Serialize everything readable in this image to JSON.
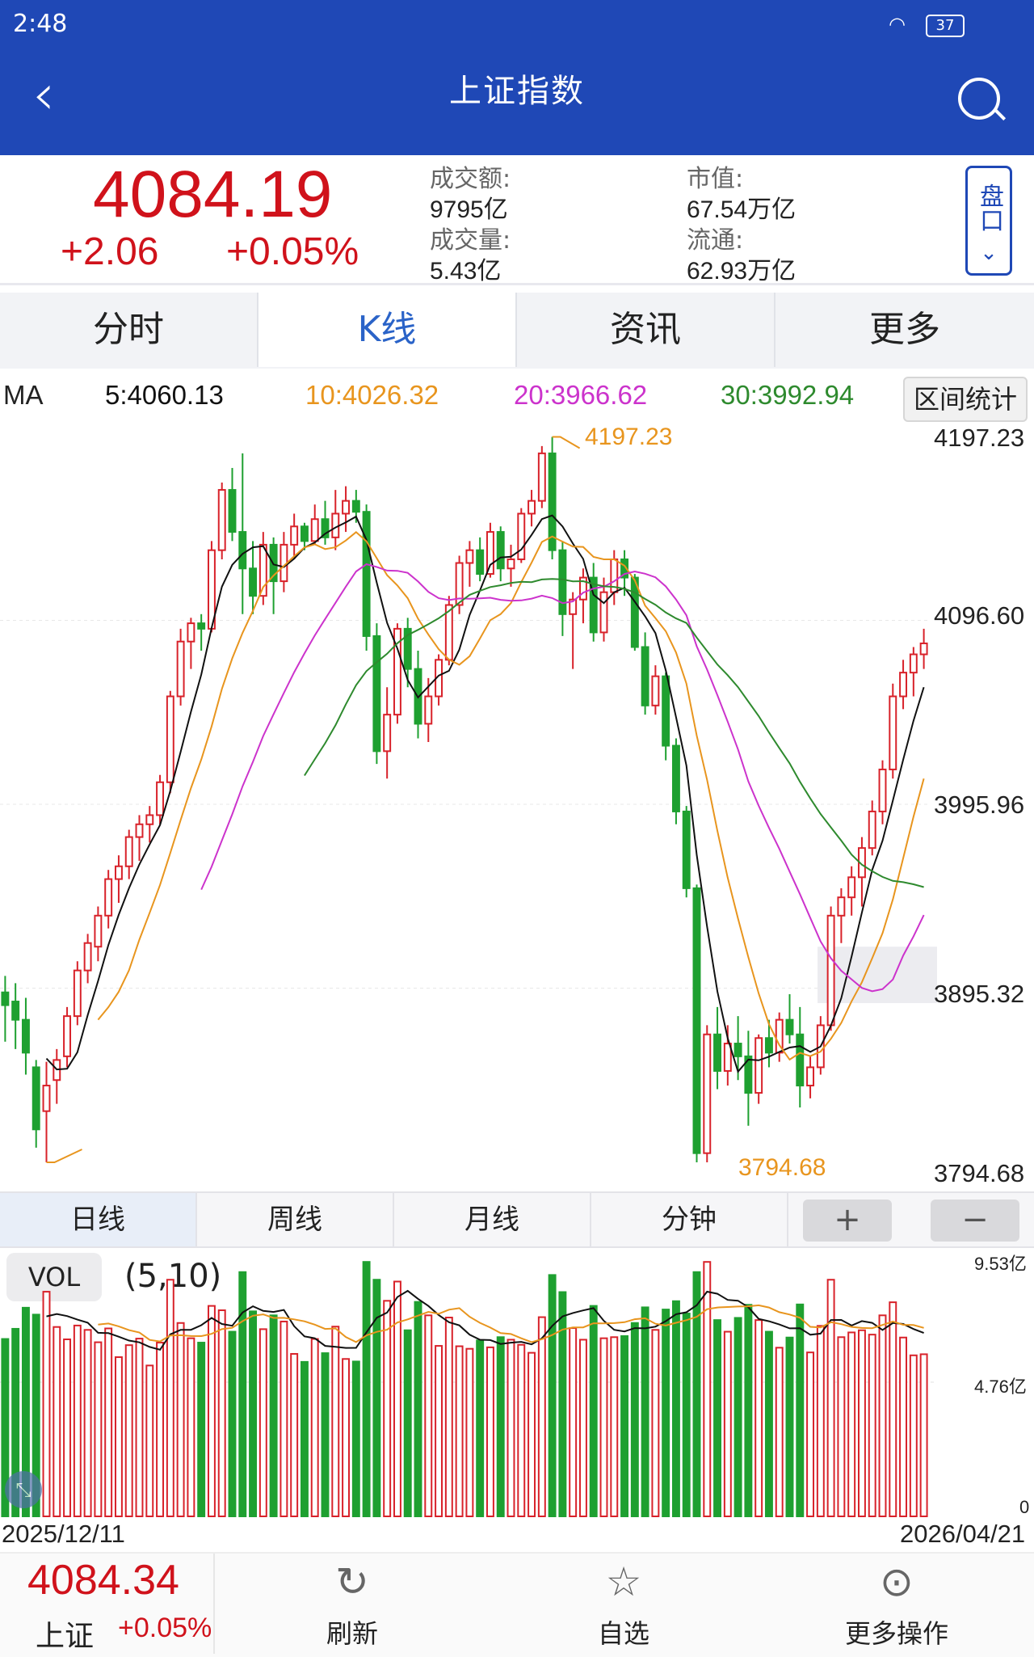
{
  "status": {
    "time": "2:48",
    "battery": "37"
  },
  "header": {
    "title": "上证指数"
  },
  "quote": {
    "price": "4084.19",
    "change": "+2.06",
    "change_pct": "+0.05%",
    "turnover_label": "成交额:",
    "turnover": "9795亿",
    "volume_label": "成交量:",
    "volume": "5.43亿",
    "mktcap_label": "市值:",
    "mktcap": "67.54万亿",
    "float_label": "流通:",
    "float_cap": "62.93万亿",
    "pankou": "盘口"
  },
  "tabs": [
    "分时",
    "K线",
    "资讯",
    "更多"
  ],
  "ma": {
    "label": "MA",
    "ma5": "5:4060.13",
    "ma10": "10:4026.32",
    "ma20": "20:3966.62",
    "ma30": "30:3992.94",
    "stats_button": "区间统计"
  },
  "colors": {
    "up": "#d8222a",
    "down": "#1ea030",
    "ma5": "#111111",
    "ma10": "#e8951e",
    "ma20": "#cc33cc",
    "ma30": "#2e8a2e",
    "header": "#1f48b6"
  },
  "period_tabs": [
    "日线",
    "周线",
    "月线",
    "分钟"
  ],
  "zoom": {
    "plus": "+",
    "minus": "−"
  },
  "vol": {
    "label": "VOL",
    "params": "(5,10)",
    "ticks": [
      "9.53亿",
      "4.76亿",
      "0"
    ]
  },
  "dates": {
    "start": "2025/12/11",
    "end": "2026/04/21"
  },
  "bottom": {
    "price": "4084.34",
    "name": "上证",
    "change_pct": "+0.05%",
    "refresh": "刷新",
    "watch": "自选",
    "more": "更多操作"
  },
  "chart_data": {
    "type": "candlestick",
    "y_ticks": [
      "4197.23",
      "4096.60",
      "3995.96",
      "3895.32",
      "3794.68"
    ],
    "ylim": [
      3794.68,
      4197.23
    ],
    "high_label": "4197.23",
    "low_label": "3794.68",
    "ohlc": [
      [
        3893,
        3902,
        3866,
        3886
      ],
      [
        3888,
        3898,
        3862,
        3878
      ],
      [
        3878,
        3890,
        3848,
        3860
      ],
      [
        3852,
        3856,
        3808,
        3818
      ],
      [
        3828,
        3855,
        3800,
        3842
      ],
      [
        3845,
        3862,
        3832,
        3856
      ],
      [
        3858,
        3885,
        3852,
        3880
      ],
      [
        3880,
        3910,
        3875,
        3905
      ],
      [
        3905,
        3925,
        3898,
        3920
      ],
      [
        3918,
        3940,
        3910,
        3935
      ],
      [
        3935,
        3960,
        3928,
        3955
      ],
      [
        3955,
        3968,
        3942,
        3962
      ],
      [
        3962,
        3982,
        3955,
        3978
      ],
      [
        3978,
        3990,
        3965,
        3985
      ],
      [
        3985,
        3995,
        3975,
        3990
      ],
      [
        3990,
        4012,
        3985,
        4008
      ],
      [
        4008,
        4058,
        4002,
        4055
      ],
      [
        4055,
        4092,
        4050,
        4085
      ],
      [
        4085,
        4098,
        4070,
        4095
      ],
      [
        4095,
        4100,
        4080,
        4092
      ],
      [
        4092,
        4140,
        4090,
        4135
      ],
      [
        4135,
        4172,
        4130,
        4168
      ],
      [
        4168,
        4180,
        4140,
        4145
      ],
      [
        4145,
        4188,
        4100,
        4125
      ],
      [
        4125,
        4140,
        4100,
        4110
      ],
      [
        4110,
        4145,
        4105,
        4138
      ],
      [
        4138,
        4142,
        4100,
        4118
      ],
      [
        4118,
        4145,
        4112,
        4138
      ],
      [
        4138,
        4155,
        4130,
        4148
      ],
      [
        4148,
        4150,
        4135,
        4140
      ],
      [
        4140,
        4160,
        4138,
        4152
      ],
      [
        4152,
        4162,
        4138,
        4142
      ],
      [
        4142,
        4168,
        4135,
        4155
      ],
      [
        4155,
        4170,
        4145,
        4162
      ],
      [
        4162,
        4168,
        4150,
        4156
      ],
      [
        4156,
        4160,
        4080,
        4088
      ],
      [
        4088,
        4095,
        4018,
        4025
      ],
      [
        4025,
        4060,
        4010,
        4045
      ],
      [
        4045,
        4095,
        4040,
        4092
      ],
      [
        4092,
        4098,
        4060,
        4070
      ],
      [
        4070,
        4080,
        4032,
        4040
      ],
      [
        4040,
        4065,
        4030,
        4055
      ],
      [
        4055,
        4078,
        4050,
        4075
      ],
      [
        4075,
        4110,
        4072,
        4105
      ],
      [
        4105,
        4132,
        4100,
        4128
      ],
      [
        4128,
        4140,
        4115,
        4135
      ],
      [
        4135,
        4142,
        4118,
        4122
      ],
      [
        4122,
        4150,
        4120,
        4145
      ],
      [
        4145,
        4148,
        4118,
        4125
      ],
      [
        4125,
        4138,
        4115,
        4130
      ],
      [
        4130,
        4158,
        4128,
        4155
      ],
      [
        4155,
        4168,
        4148,
        4162
      ],
      [
        4162,
        4192,
        4158,
        4188
      ],
      [
        4188,
        4197,
        4130,
        4135
      ],
      [
        4135,
        4140,
        4088,
        4100
      ],
      [
        4100,
        4112,
        4070,
        4108
      ],
      [
        4108,
        4125,
        4095,
        4120
      ],
      [
        4120,
        4128,
        4085,
        4090
      ],
      [
        4090,
        4120,
        4085,
        4112
      ],
      [
        4112,
        4135,
        4105,
        4130
      ],
      [
        4130,
        4135,
        4110,
        4120
      ],
      [
        4120,
        4122,
        4080,
        4082
      ],
      [
        4082,
        4090,
        4045,
        4050
      ],
      [
        4050,
        4072,
        4045,
        4066
      ],
      [
        4066,
        4068,
        4020,
        4028
      ],
      [
        4028,
        4032,
        3985,
        3992
      ],
      [
        3992,
        3995,
        3945,
        3950
      ],
      [
        3950,
        3952,
        3800,
        3805
      ],
      [
        3805,
        3875,
        3800,
        3870
      ],
      [
        3870,
        3885,
        3840,
        3850
      ],
      [
        3850,
        3875,
        3842,
        3865
      ],
      [
        3865,
        3880,
        3845,
        3858
      ],
      [
        3858,
        3872,
        3820,
        3838
      ],
      [
        3838,
        3870,
        3832,
        3868
      ],
      [
        3868,
        3878,
        3852,
        3860
      ],
      [
        3860,
        3882,
        3855,
        3878
      ],
      [
        3878,
        3892,
        3865,
        3870
      ],
      [
        3870,
        3885,
        3830,
        3842
      ],
      [
        3842,
        3858,
        3835,
        3852
      ],
      [
        3852,
        3880,
        3848,
        3875
      ],
      [
        3875,
        3940,
        3872,
        3935
      ],
      [
        3935,
        3950,
        3920,
        3945
      ],
      [
        3945,
        3962,
        3935,
        3956
      ],
      [
        3956,
        3978,
        3940,
        3972
      ],
      [
        3972,
        3998,
        3968,
        3992
      ],
      [
        3992,
        4020,
        3985,
        4015
      ],
      [
        4015,
        4062,
        4010,
        4055
      ],
      [
        4055,
        4075,
        4048,
        4068
      ],
      [
        4068,
        4082,
        4055,
        4078
      ],
      [
        4078,
        4092,
        4070,
        4084
      ]
    ],
    "ma5_series_label": "MA5",
    "ma10_series_label": "MA10",
    "ma20_series_label": "MA20",
    "ma30_series_label": "MA30",
    "vol_ylim": [
      0,
      9.53
    ]
  }
}
